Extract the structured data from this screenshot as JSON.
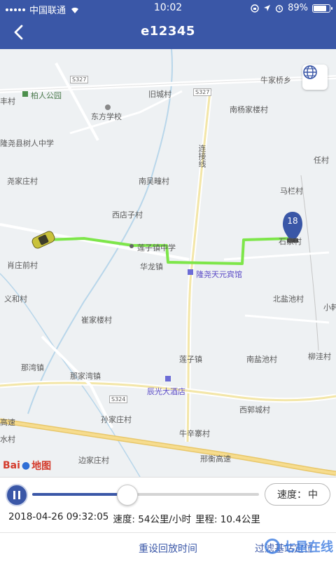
{
  "status_bar": {
    "carrier": "中国联通",
    "time": "10:02",
    "battery": "89%",
    "battery_level": 0.89
  },
  "header": {
    "title": "e12345"
  },
  "map": {
    "labels": {
      "qian_cun": "丰村",
      "bairen_park": "柏人公园",
      "jiuchengcun": "旧城村",
      "niujiaqiao": "牛家桥乡",
      "dongfang_school": "东方学校",
      "nanyangjialou": "南杨家楼村",
      "longyao_shuren": "隆尧县树人中学",
      "lianjiexian": "连接线",
      "rencun": "任村",
      "yaojiazhuang": "尧家庄村",
      "nanwujiancun": "南吴疃村",
      "malancun": "马栏村",
      "xidianzi": "西店子村",
      "lianzi_middle": "莲子镇中学",
      "shijiacun": "石家村",
      "xiaojiaqian": "肖庄前村",
      "hualong": "华龙镇",
      "longyao_hotel": "隆尧天元宾馆",
      "yihecun": "义和村",
      "beiyanchi": "北盐池村",
      "xiaoxi": "小韩",
      "cuijialou": "崔家楼村",
      "lianzizhen": "莲子镇",
      "nayanchi": "南盐池村",
      "liuwacun": "柳洼村",
      "nawan": "那湾镇",
      "najiawan": "那家湾镇",
      "chenguang_hotel": "辰光大酒店",
      "xiguocheng": "西郭城村",
      "sunjiazhuang": "孙家庄村",
      "sanshui": "水村",
      "niuxinzhai": "牛辛寨村",
      "xingheng": "邢衡高速",
      "bianjiazhuang": "边家庄村",
      "gaosu_left": "高速",
      "road_s327": "S327",
      "road_s327b": "S327",
      "road_s324": "S324"
    },
    "marker_number": "18",
    "baidu_logo_a": "Bai",
    "baidu_logo_b": "地图"
  },
  "playback": {
    "progress": 0.42,
    "speed_label": "速度：",
    "speed_value": "中",
    "datetime": "2018-04-26 09:32:05",
    "speed_info": "速度: 54公里/小时",
    "mileage_info": "里程: 10.4公里"
  },
  "actions": {
    "reset": "重设回放时间",
    "filter": "过滤基站定位"
  },
  "watermark": "七星在线"
}
